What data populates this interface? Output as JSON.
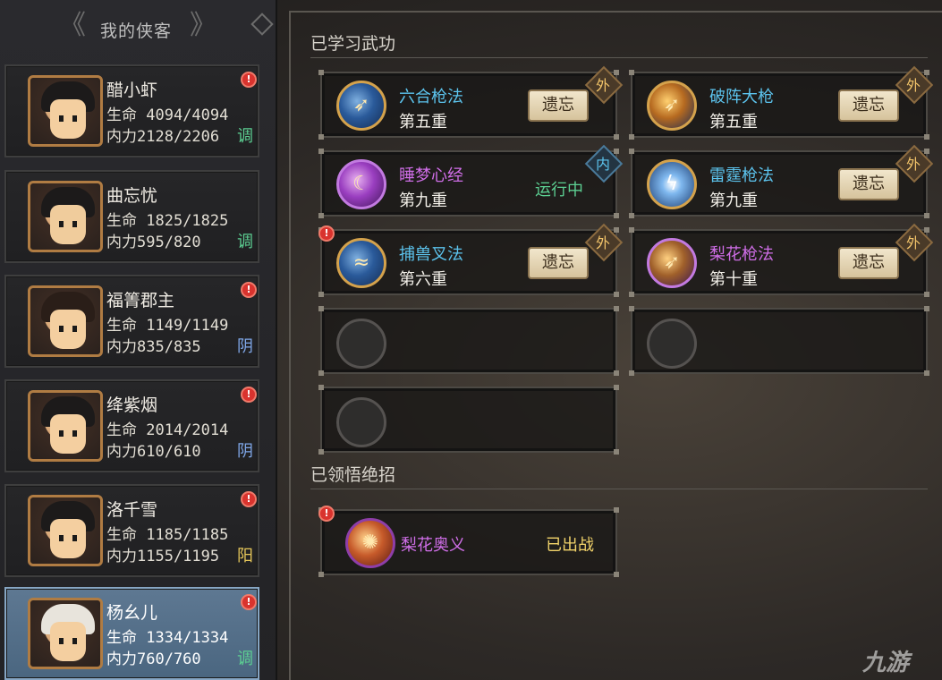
{
  "left_panel": {
    "title": "我的侠客",
    "characters": [
      {
        "name": "醋小虾",
        "hp_label": "生命",
        "hp": "4094/4094",
        "mp_label": "内力",
        "mp": "2128/2206",
        "tag": "调",
        "alert": "!"
      },
      {
        "name": "曲忘忧",
        "hp_label": "生命",
        "hp": "1825/1825",
        "mp_label": "内力",
        "mp": "595/820",
        "tag": "调",
        "alert": ""
      },
      {
        "name": "福箐郡主",
        "hp_label": "生命",
        "hp": "1149/1149",
        "mp_label": "内力",
        "mp": "835/835",
        "tag": "阴",
        "alert": "!"
      },
      {
        "name": "绛紫烟",
        "hp_label": "生命",
        "hp": "2014/2014",
        "mp_label": "内力",
        "mp": "610/610",
        "tag": "阴",
        "alert": "!"
      },
      {
        "name": "洛千雪",
        "hp_label": "生命",
        "hp": "1185/1185",
        "mp_label": "内力",
        "mp": "1155/1195",
        "tag": "阳",
        "alert": "!"
      },
      {
        "name": "杨幺儿",
        "hp_label": "生命",
        "hp": "1334/1334",
        "mp_label": "内力",
        "mp": "760/760",
        "tag": "调",
        "alert": "!"
      }
    ],
    "selected_index": 5
  },
  "learned": {
    "title": "已学习武功",
    "forget_label": "遗忘",
    "running_label": "运行中",
    "skills": [
      {
        "name": "六合枪法",
        "level": "第五重",
        "type": "外",
        "alert": ""
      },
      {
        "name": "破阵大枪",
        "level": "第五重",
        "type": "外",
        "alert": ""
      },
      {
        "name": "睡梦心经",
        "level": "第九重",
        "type": "内",
        "alert": ""
      },
      {
        "name": "雷霆枪法",
        "level": "第九重",
        "type": "外",
        "alert": ""
      },
      {
        "name": "捕兽叉法",
        "level": "第六重",
        "type": "外",
        "alert": "!"
      },
      {
        "name": "梨花枪法",
        "level": "第十重",
        "type": "外",
        "alert": ""
      }
    ]
  },
  "ultimate": {
    "title": "已领悟绝招",
    "skill_name": "梨花奥义",
    "status": "已出战",
    "alert": "!"
  },
  "watermark": "九游",
  "colors": {
    "tag_tiao": "#5ccf92",
    "tag_yin": "#7fa7e8",
    "tag_yang": "#e6c75a",
    "skill_name_blue": "#5cc4ee",
    "skill_name_purple": "#d06ee8",
    "selected_card": "#5e7892"
  },
  "icons": [
    "arrow-left-icon",
    "arrow-right-icon",
    "diamond-icon",
    "alert-icon",
    "spear-icon",
    "mind-icon",
    "lightning-icon",
    "blossom-icon",
    "trident-icon",
    "empty-slot-icon"
  ]
}
